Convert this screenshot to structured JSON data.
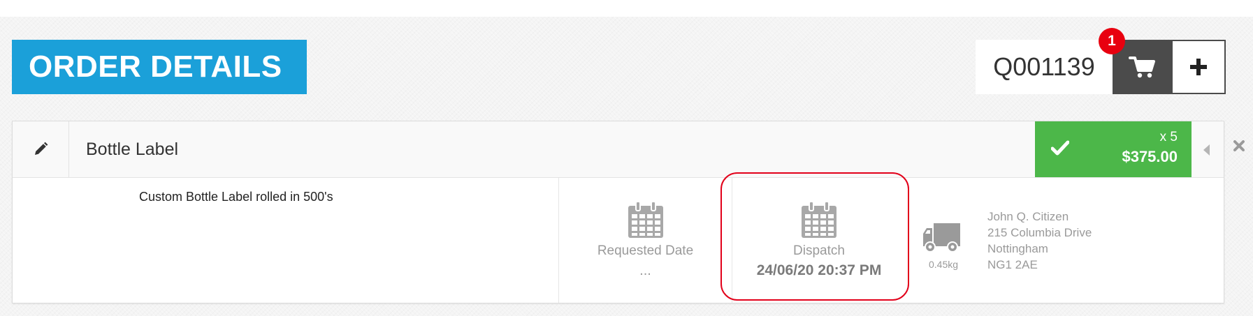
{
  "page": {
    "title": "ORDER DETAILS"
  },
  "order": {
    "id": "Q001139",
    "cart_count": "1",
    "add_label": "+"
  },
  "icons": {
    "edit": "pencil-icon",
    "cart": "cart-icon",
    "check": "check-icon",
    "collapse": "caret-left-icon",
    "close": "close-icon",
    "calendar": "calendar-icon",
    "truck": "truck-icon"
  },
  "colors": {
    "title_bg": "#1ba0d9",
    "status_green": "#4cb749",
    "badge_red": "#e8000f",
    "cart_bg": "#4b4b4b",
    "highlight": "#e2001a"
  },
  "item": {
    "name": "Bottle Label",
    "quantity": "x 5",
    "price": "$375.00",
    "description": "Custom Bottle Label rolled in 500's",
    "requested_date": {
      "label": "Requested Date",
      "value": "..."
    },
    "dispatch": {
      "label": "Dispatch",
      "value": "24/06/20 20:37 PM"
    },
    "shipping": {
      "weight": "0.45kg",
      "address": [
        "John Q. Citizen",
        "215 Columbia Drive",
        "Nottingham",
        "NG1 2AE"
      ]
    }
  }
}
